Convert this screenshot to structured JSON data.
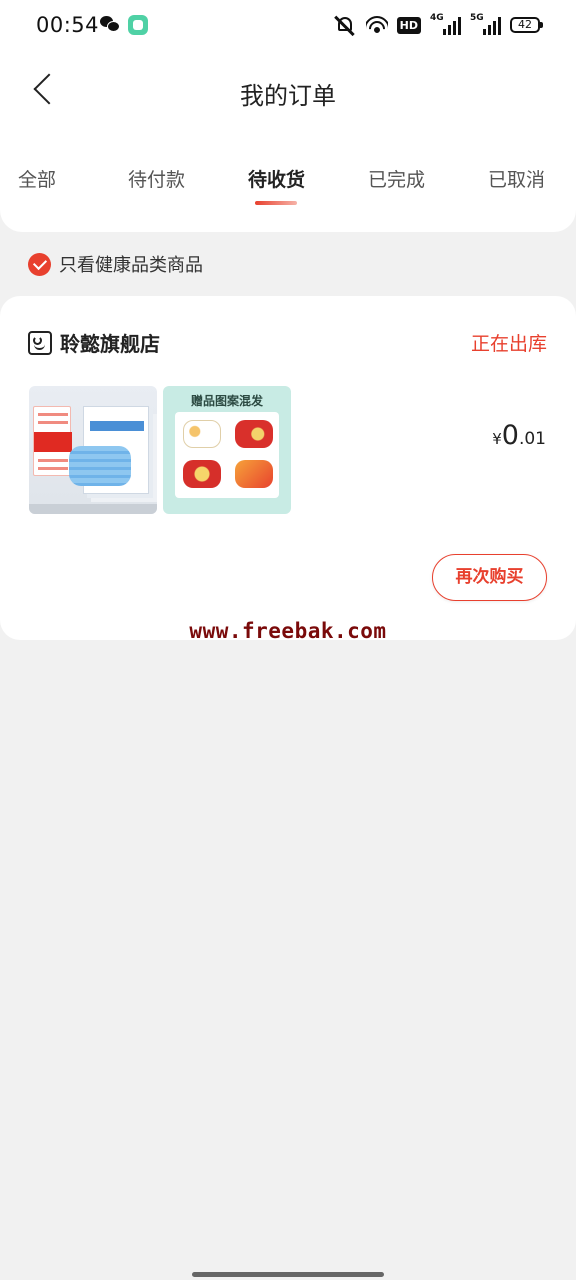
{
  "status_bar": {
    "time": "00:54",
    "left_icons": [
      "wechat-icon",
      "app-icon"
    ],
    "network_4g": "4G",
    "network_5g": "5G",
    "hd_label": "HD",
    "battery": "42"
  },
  "header": {
    "title": "我的订单",
    "back_icon": "chevron-left-icon"
  },
  "tabs": [
    {
      "label": "全部",
      "active": false
    },
    {
      "label": "待付款",
      "active": false
    },
    {
      "label": "待收货",
      "active": true
    },
    {
      "label": "已完成",
      "active": false
    },
    {
      "label": "已取消",
      "active": false
    }
  ],
  "filter": {
    "label": "只看健康品类商品",
    "checked": true
  },
  "order": {
    "store_name": "聆懿旗舰店",
    "status": "正在出库",
    "gift_image_title": "赠品图案混发",
    "price": {
      "symbol": "¥",
      "integer": "0",
      "decimal": ".01"
    },
    "rebuy_button": "再次购买"
  },
  "watermark": "www.freebak.com",
  "colors": {
    "accent": "#e8402e",
    "background": "#f1f1f1",
    "card": "#ffffff"
  }
}
